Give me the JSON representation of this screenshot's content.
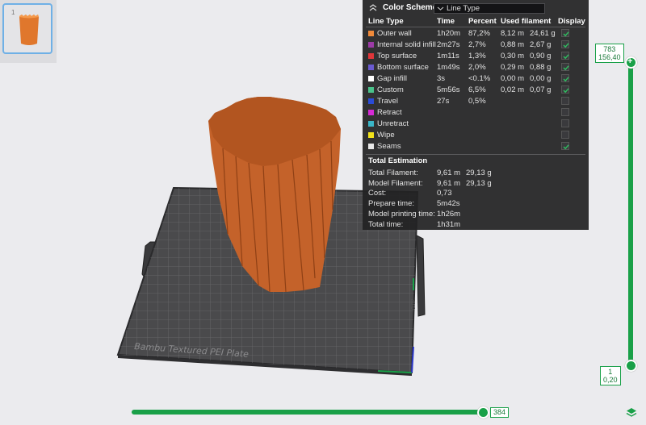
{
  "thumbnail": {
    "index": "1"
  },
  "plate": {
    "label": "Bambu Textured PEI Plate"
  },
  "panel": {
    "title": "Color Scheme",
    "scheme_value": "Line Type",
    "headers": {
      "line_type": "Line Type",
      "time": "Time",
      "percent": "Percent",
      "used_filament": "Used filament",
      "display": "Display"
    },
    "rows": [
      {
        "name": "Outer wall",
        "color": "#f08a3a",
        "time": "1h20m",
        "percent": "87,2%",
        "length": "8,12 m",
        "weight": "24,61 g",
        "checked": true
      },
      {
        "name": "Internal solid infill",
        "color": "#9b3aa6",
        "time": "2m27s",
        "percent": "2,7%",
        "length": "0,88 m",
        "weight": "2,67 g",
        "checked": true
      },
      {
        "name": "Top surface",
        "color": "#e0363a",
        "time": "1m11s",
        "percent": "1,3%",
        "length": "0,30 m",
        "weight": "0,90 g",
        "checked": true
      },
      {
        "name": "Bottom surface",
        "color": "#6a5ad0",
        "time": "1m49s",
        "percent": "2,0%",
        "length": "0,29 m",
        "weight": "0,88 g",
        "checked": true
      },
      {
        "name": "Gap infill",
        "color": "#ffffff",
        "time": "3s",
        "percent": "<0.1%",
        "length": "0,00 m",
        "weight": "0,00 g",
        "checked": true
      },
      {
        "name": "Custom",
        "color": "#4ac28a",
        "time": "5m56s",
        "percent": "6,5%",
        "length": "0,02 m",
        "weight": "0,07 g",
        "checked": true
      },
      {
        "name": "Travel",
        "color": "#2a4bd6",
        "time": "27s",
        "percent": "0,5%",
        "length": "",
        "weight": "",
        "checked": false
      },
      {
        "name": "Retract",
        "color": "#d62ad6",
        "time": "",
        "percent": "",
        "length": "",
        "weight": "",
        "checked": false
      },
      {
        "name": "Unretract",
        "color": "#3ab6c8",
        "time": "",
        "percent": "",
        "length": "",
        "weight": "",
        "checked": false
      },
      {
        "name": "Wipe",
        "color": "#f2e21a",
        "time": "",
        "percent": "",
        "length": "",
        "weight": "",
        "checked": false
      },
      {
        "name": "Seams",
        "color": "#e8e8e8",
        "time": "",
        "percent": "",
        "length": "",
        "weight": "",
        "checked": true
      }
    ],
    "estimation_title": "Total Estimation",
    "estimation": [
      {
        "label": "Total Filament:",
        "value": "9,61 m",
        "extra": "29,13 g"
      },
      {
        "label": "Model Filament:",
        "value": "9,61 m",
        "extra": "29,13 g"
      },
      {
        "label": "Cost:",
        "value": "0,73",
        "extra": ""
      },
      {
        "label": "Prepare time:",
        "value": "5m42s",
        "extra": ""
      },
      {
        "label": "Model printing time:",
        "value": "1h26m",
        "extra": ""
      },
      {
        "label": "Total time:",
        "value": "1h31m",
        "extra": ""
      }
    ]
  },
  "layer_slider": {
    "top_layer": "783",
    "top_height": "156,40",
    "bottom_layer": "1",
    "bottom_height": "0,20"
  },
  "move_slider": {
    "value": "384"
  },
  "colors": {
    "accent": "#19a048",
    "model": "#c4622a"
  }
}
